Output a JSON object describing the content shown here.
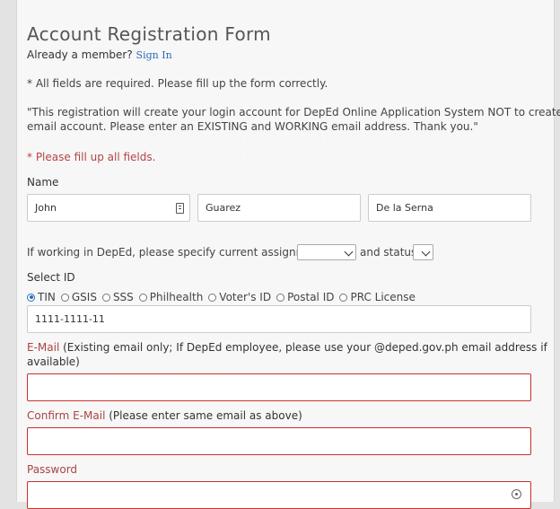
{
  "form": {
    "title": "Account Registration Form",
    "already_member": "Already a member?",
    "sign_in": "Sign In",
    "required_note": "* All fields are required. Please fill up the form correctly.",
    "notice_line1": "\"This registration will create your login account for DepEd Online Application System NOT to create an",
    "notice_line2": "email account. Please enter an EXISTING and WORKING email address. Thank you.\"",
    "warning": "* Please fill up all fields.",
    "name_label": "Name",
    "first_name": "John",
    "middle_name": "Guarez",
    "last_name": "De la Serna",
    "assignment_text": "If working in DepEd, please specify current assignment",
    "assignment_value": "",
    "status_text": "and status",
    "status_value": "",
    "select_id_label": "Select ID",
    "id_options": [
      "TIN",
      "GSIS",
      "SSS",
      "Philhealth",
      "Voter's ID",
      "Postal ID",
      "PRC License"
    ],
    "id_selected": "TIN",
    "id_number": "1111-1111-11",
    "email_label": "E-Mail",
    "email_hint_line1": " (Existing email only; If DepEd employee, please use your @deped.gov.ph email address if",
    "email_hint_line2": "available)",
    "email_value": "",
    "confirm_label": "Confirm E-Mail",
    "confirm_hint": " (Please enter same email as above)",
    "confirm_value": "",
    "password_label": "Password",
    "password_value": ""
  },
  "colors": {
    "link": "#2a6fb5",
    "error": "#a94442",
    "error_border": "#c9302c"
  }
}
